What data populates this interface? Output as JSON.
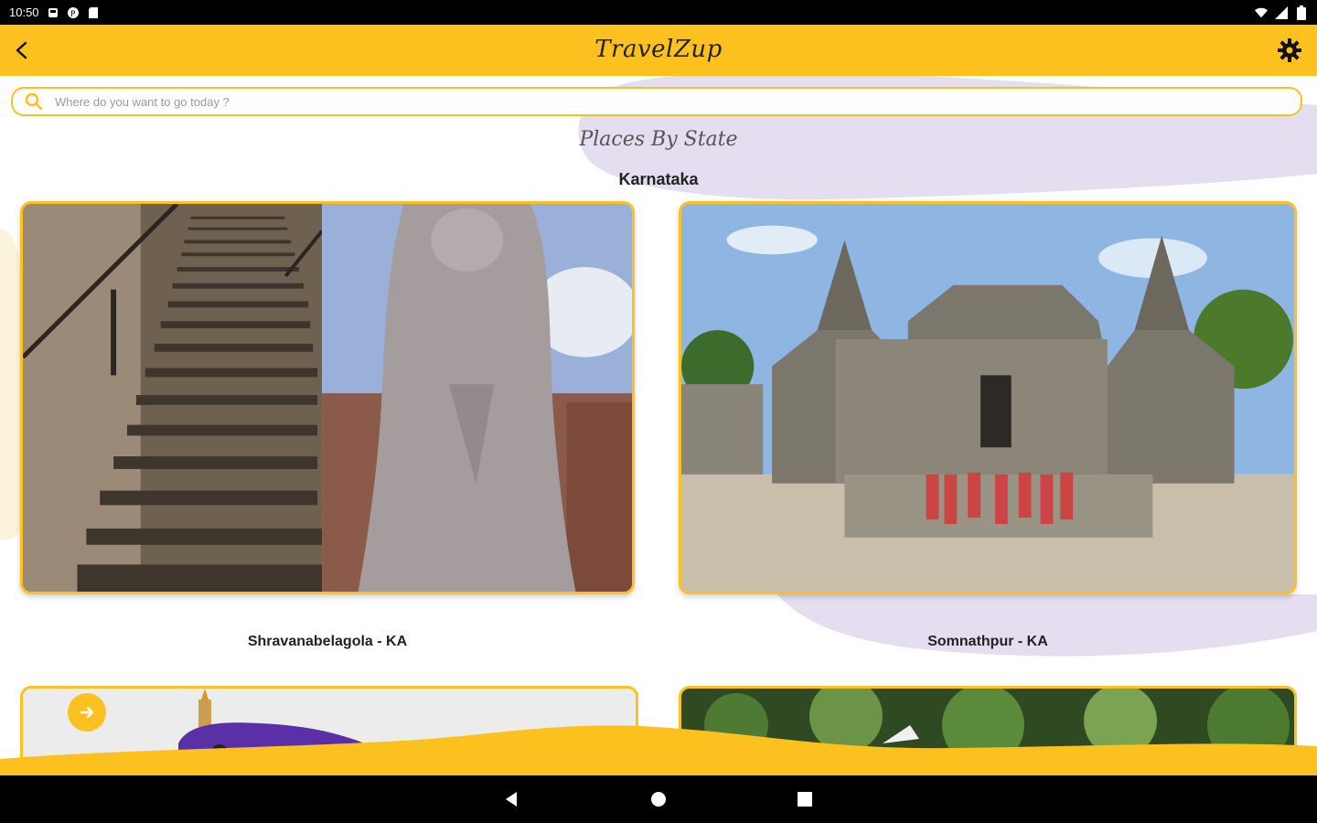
{
  "status_bar": {
    "time": "10:50",
    "icons_left": [
      "notification-icon",
      "app-icon",
      "sd-card-icon"
    ],
    "icons_right": [
      "wifi-icon",
      "signal-icon",
      "battery-icon"
    ]
  },
  "app_bar": {
    "title": "TravelZup",
    "back_icon": "back-arrow-icon",
    "settings_icon": "gear-icon"
  },
  "search": {
    "placeholder": "Where do you want to go today ?",
    "value": ""
  },
  "section": {
    "title": "Places By State",
    "state": "Karnataka"
  },
  "places": [
    {
      "label": "Shravanabelagola - KA"
    },
    {
      "label": "Somnathpur - KA"
    }
  ],
  "colors": {
    "accent": "#FDC11F",
    "blob": "#E4DEF0",
    "car": "#5A2FA8"
  },
  "nav_bar": {
    "buttons": [
      "back-triangle-icon",
      "home-circle-icon",
      "recents-square-icon"
    ]
  }
}
